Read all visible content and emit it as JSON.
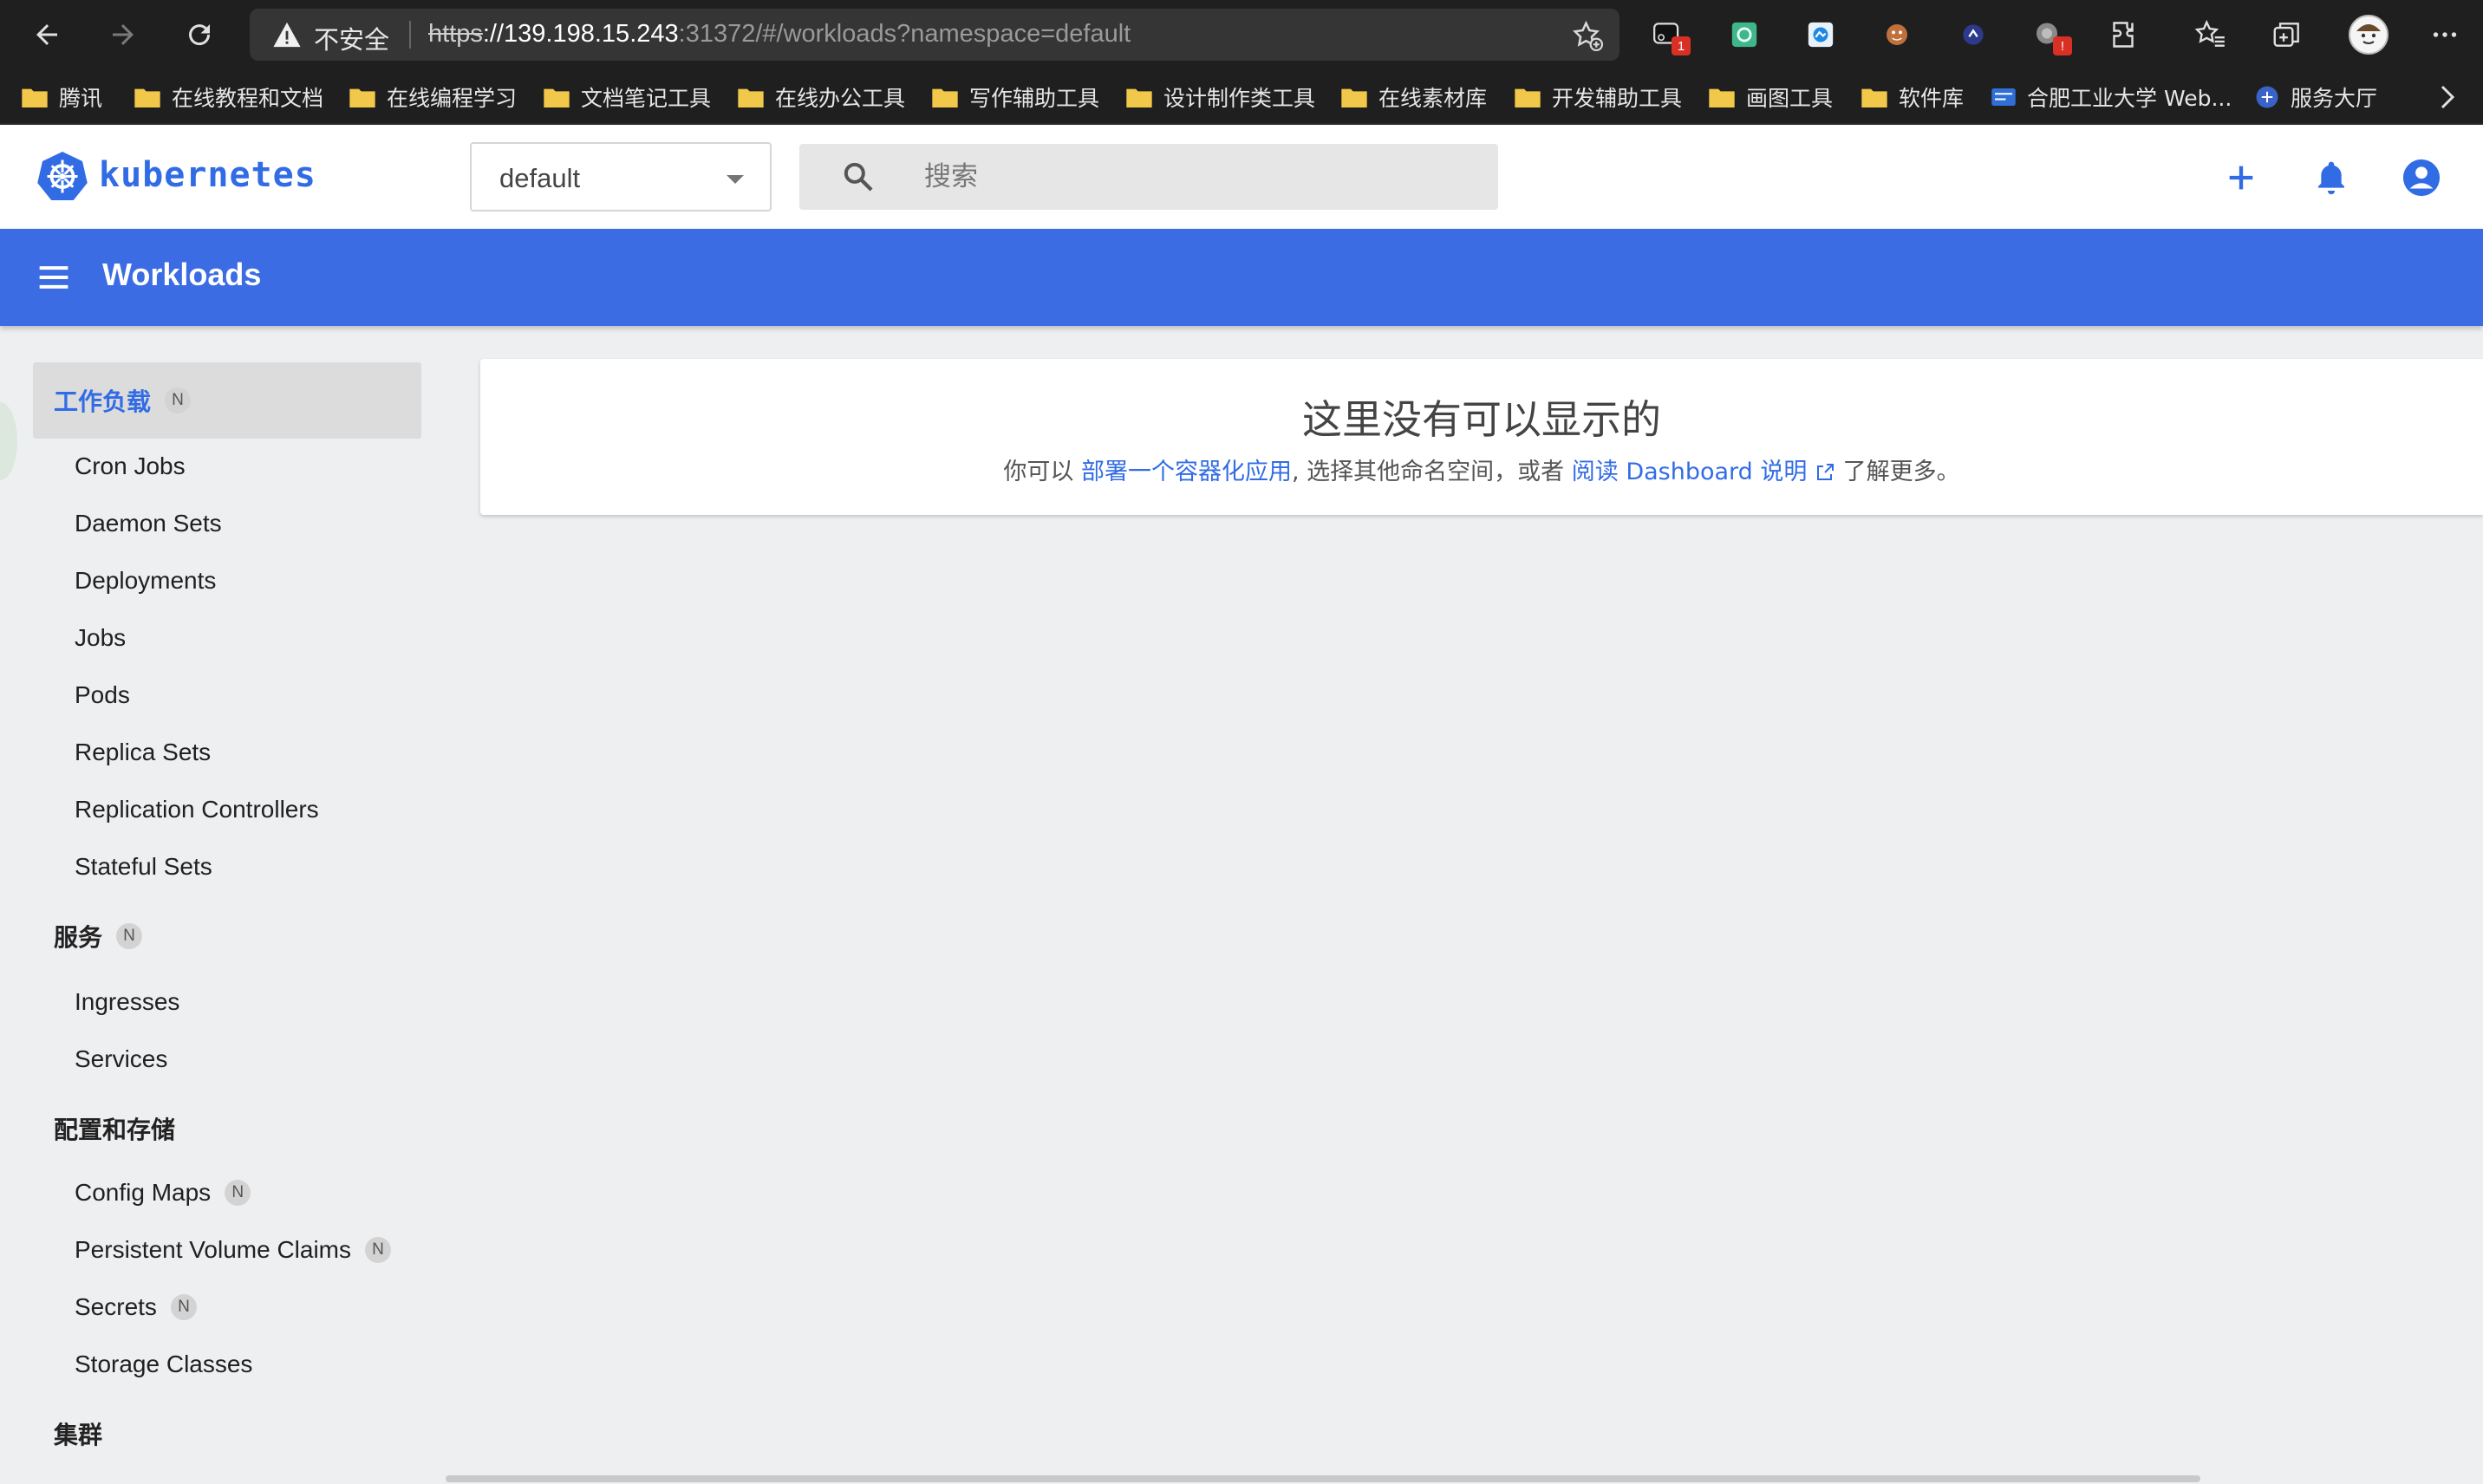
{
  "browser": {
    "insecure_label": "不安全",
    "url_scheme": "https",
    "url_host": "://139.198.15.243",
    "url_rest": ":31372/#/workloads?namespace=default",
    "extension_badge_1": "1",
    "extension_badge_2": "!"
  },
  "bookmarks": [
    {
      "label": "腾讯",
      "icon": "folder-icon"
    },
    {
      "label": "在线教程和文档",
      "icon": "folder-icon"
    },
    {
      "label": "在线编程学习",
      "icon": "folder-icon"
    },
    {
      "label": "文档笔记工具",
      "icon": "folder-icon"
    },
    {
      "label": "在线办公工具",
      "icon": "folder-icon"
    },
    {
      "label": "写作辅助工具",
      "icon": "folder-icon"
    },
    {
      "label": "设计制作类工具",
      "icon": "folder-icon"
    },
    {
      "label": "在线素材库",
      "icon": "folder-icon"
    },
    {
      "label": "开发辅助工具",
      "icon": "folder-icon"
    },
    {
      "label": "画图工具",
      "icon": "folder-icon"
    },
    {
      "label": "软件库",
      "icon": "folder-icon"
    },
    {
      "label": "合肥工业大学 Web...",
      "icon": "site-icon"
    },
    {
      "label": "服务大厅",
      "icon": "site-icon"
    }
  ],
  "header": {
    "logo_text": "kubernetes",
    "namespace": "default",
    "search_placeholder": "搜索"
  },
  "toolbar": {
    "title": "Workloads"
  },
  "sidebar": {
    "workloads": {
      "label": "工作负载",
      "badge": "N"
    },
    "workload_items": [
      {
        "label": "Cron Jobs"
      },
      {
        "label": "Daemon Sets"
      },
      {
        "label": "Deployments"
      },
      {
        "label": "Jobs"
      },
      {
        "label": "Pods"
      },
      {
        "label": "Replica Sets"
      },
      {
        "label": "Replication Controllers"
      },
      {
        "label": "Stateful Sets"
      }
    ],
    "services": {
      "label": "服务",
      "badge": "N"
    },
    "service_items": [
      {
        "label": "Ingresses"
      },
      {
        "label": "Services"
      }
    ],
    "config": {
      "label": "配置和存储"
    },
    "config_items": [
      {
        "label": "Config Maps",
        "badge": "N"
      },
      {
        "label": "Persistent Volume Claims",
        "badge": "N"
      },
      {
        "label": "Secrets",
        "badge": "N"
      },
      {
        "label": "Storage Classes"
      }
    ],
    "cluster": {
      "label": "集群"
    }
  },
  "empty_state": {
    "title": "这里没有可以显示的",
    "prefix": "你可以 ",
    "deploy_link": "部署一个容器化应用",
    "middle": ", 选择其他命名空间，或者 ",
    "docs_link": "阅读 Dashboard 说明",
    "suffix": " 了解更多。"
  },
  "colors": {
    "brand_blue": "#326ce5",
    "toolbar_blue": "#3b6ce4",
    "browser_dark": "#1f1f1f"
  }
}
